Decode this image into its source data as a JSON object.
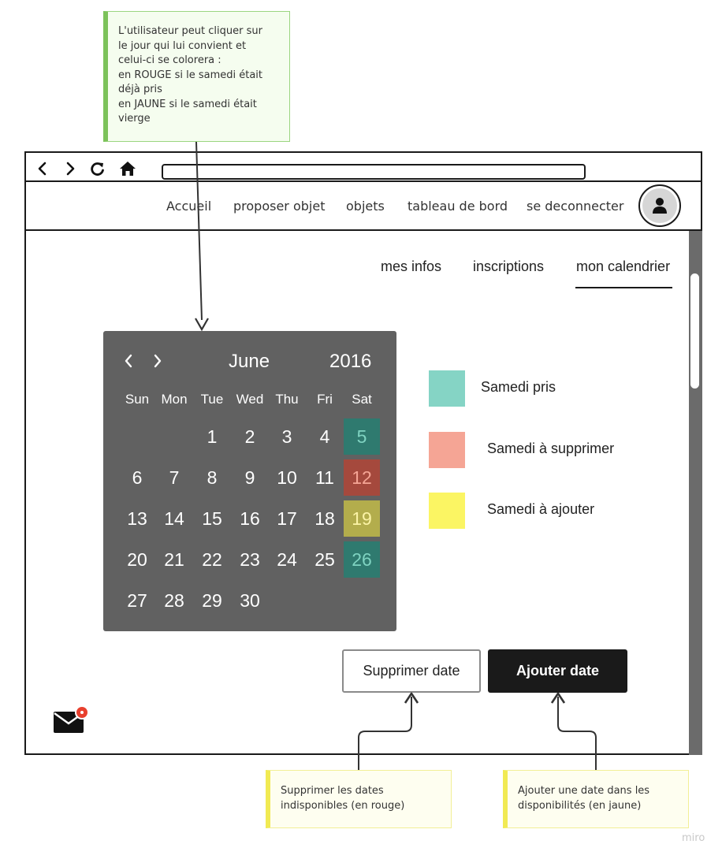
{
  "annotations": {
    "calendar_note": [
      "L'utilisateur peut cliquer sur",
      "le jour qui lui convient et",
      "celui-ci se colorera :",
      "en ROUGE si le samedi était",
      "déjà pris",
      "en JAUNE si le samedi était",
      "vierge"
    ],
    "delete_note": [
      "Supprimer les dates",
      "indisponibles (en rouge)"
    ],
    "add_note": [
      "Ajouter une date dans les",
      "disponibilités (en jaune)"
    ]
  },
  "browser": {
    "back_icon": "chevron-left-icon",
    "forward_icon": "chevron-right-icon",
    "reload_icon": "reload-icon",
    "home_icon": "home-icon",
    "url": ""
  },
  "menu": {
    "items": [
      "Accueil",
      "proposer objet",
      "objets",
      "tableau de bord",
      "se deconnecter"
    ],
    "avatar_icon": "user-icon"
  },
  "subtabs": {
    "items": [
      "mes infos",
      "inscriptions",
      "mon calendrier"
    ],
    "active": "mon calendrier"
  },
  "calendar": {
    "month": "June",
    "year": "2016",
    "weekdays": [
      "Sun",
      "Mon",
      "Tue",
      "Wed",
      "Thu",
      "Fri",
      "Sat"
    ],
    "weeks": [
      [
        "",
        "",
        "1",
        "2",
        "3",
        "4",
        "5"
      ],
      [
        "6",
        "7",
        "8",
        "9",
        "10",
        "11",
        "12"
      ],
      [
        "13",
        "14",
        "15",
        "16",
        "17",
        "18",
        "19"
      ],
      [
        "20",
        "21",
        "22",
        "23",
        "24",
        "25",
        "26"
      ],
      [
        "27",
        "28",
        "29",
        "30",
        "",
        "",
        ""
      ]
    ],
    "highlighted": [
      {
        "day": "5",
        "status": "pris"
      },
      {
        "day": "12",
        "status": "supprimer"
      },
      {
        "day": "19",
        "status": "ajouter"
      },
      {
        "day": "26",
        "status": "pris"
      }
    ]
  },
  "legend": [
    {
      "label": "Samedi pris",
      "color": "#85d4c5"
    },
    {
      "label": "Samedi à supprimer",
      "color": "#f5a595"
    },
    {
      "label": "Samedi à ajouter",
      "color": "#fbf563"
    }
  ],
  "colors": {
    "calendar_bg": "#616161",
    "pris_cell": "#2f7a6f",
    "pris_text": "#7fd3c1",
    "supprimer_cell": "#a5493d",
    "supprimer_text": "#f5a595",
    "ajouter_cell": "#b3ad4c",
    "ajouter_text": "#fbf3a6",
    "notification": "#e8402e"
  },
  "buttons": {
    "delete": "Supprimer date",
    "add": "Ajouter date"
  },
  "mail": {
    "icon": "mail-icon",
    "badge_icon": "notification-dot-icon"
  },
  "watermark": "miro"
}
